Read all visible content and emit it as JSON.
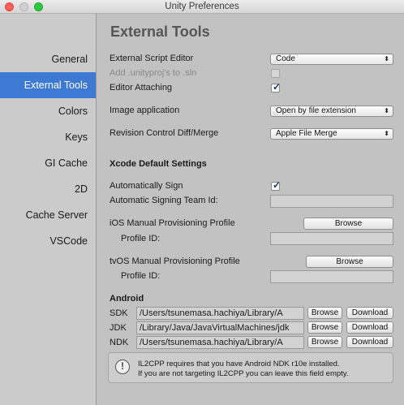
{
  "window": {
    "title": "Unity Preferences"
  },
  "sidebar": {
    "items": [
      {
        "label": "General"
      },
      {
        "label": "External Tools"
      },
      {
        "label": "Colors"
      },
      {
        "label": "Keys"
      },
      {
        "label": "GI Cache"
      },
      {
        "label": "2D"
      },
      {
        "label": "Cache Server"
      },
      {
        "label": "VSCode"
      }
    ],
    "selected": "External Tools",
    "selected_color": "#3e7ad3"
  },
  "main": {
    "title": "External Tools",
    "script_editor": {
      "label": "External Script Editor",
      "value": "Code"
    },
    "add_unityproj": {
      "label": "Add .unityproj's to .sln",
      "checked": false,
      "disabled": true
    },
    "editor_attaching": {
      "label": "Editor Attaching",
      "checked": true,
      "mark": "✓"
    },
    "image_app": {
      "label": "Image application",
      "value": "Open by file extension"
    },
    "revision_control": {
      "label": "Revision Control Diff/Merge",
      "value": "Apple File Merge"
    },
    "xcode": {
      "heading": "Xcode Default Settings",
      "auto_sign": {
        "label": "Automatically Sign",
        "checked": true,
        "mark": "✓"
      },
      "team_id": {
        "label": "Automatic Signing Team Id:",
        "value": ""
      },
      "ios_profile": {
        "label": "iOS Manual Provisioning Profile",
        "button": "Browse",
        "profile_id_label": "Profile ID:",
        "profile_id_value": ""
      },
      "tvos_profile": {
        "label": "tvOS Manual Provisioning Profile",
        "button": "Browse",
        "profile_id_label": "Profile ID:",
        "profile_id_value": ""
      }
    },
    "android": {
      "heading": "Android",
      "sdk": {
        "label": "SDK",
        "path": "/Users/tsunemasa.hachiya/Library/A",
        "browse": "Browse",
        "download": "Download"
      },
      "jdk": {
        "label": "JDK",
        "path": "/Library/Java/JavaVirtualMachines/jdk",
        "browse": "Browse",
        "download": "Download"
      },
      "ndk": {
        "label": "NDK",
        "path": "/Users/tsunemasa.hachiya/Library/A",
        "browse": "Browse",
        "download": "Download"
      },
      "info": {
        "icon": "info-icon",
        "line1": "IL2CPP requires that you have Android NDK r10e installed.",
        "line2": "If you are not targeting IL2CPP you can leave this field empty."
      }
    },
    "popup_arrows": "⬍"
  }
}
